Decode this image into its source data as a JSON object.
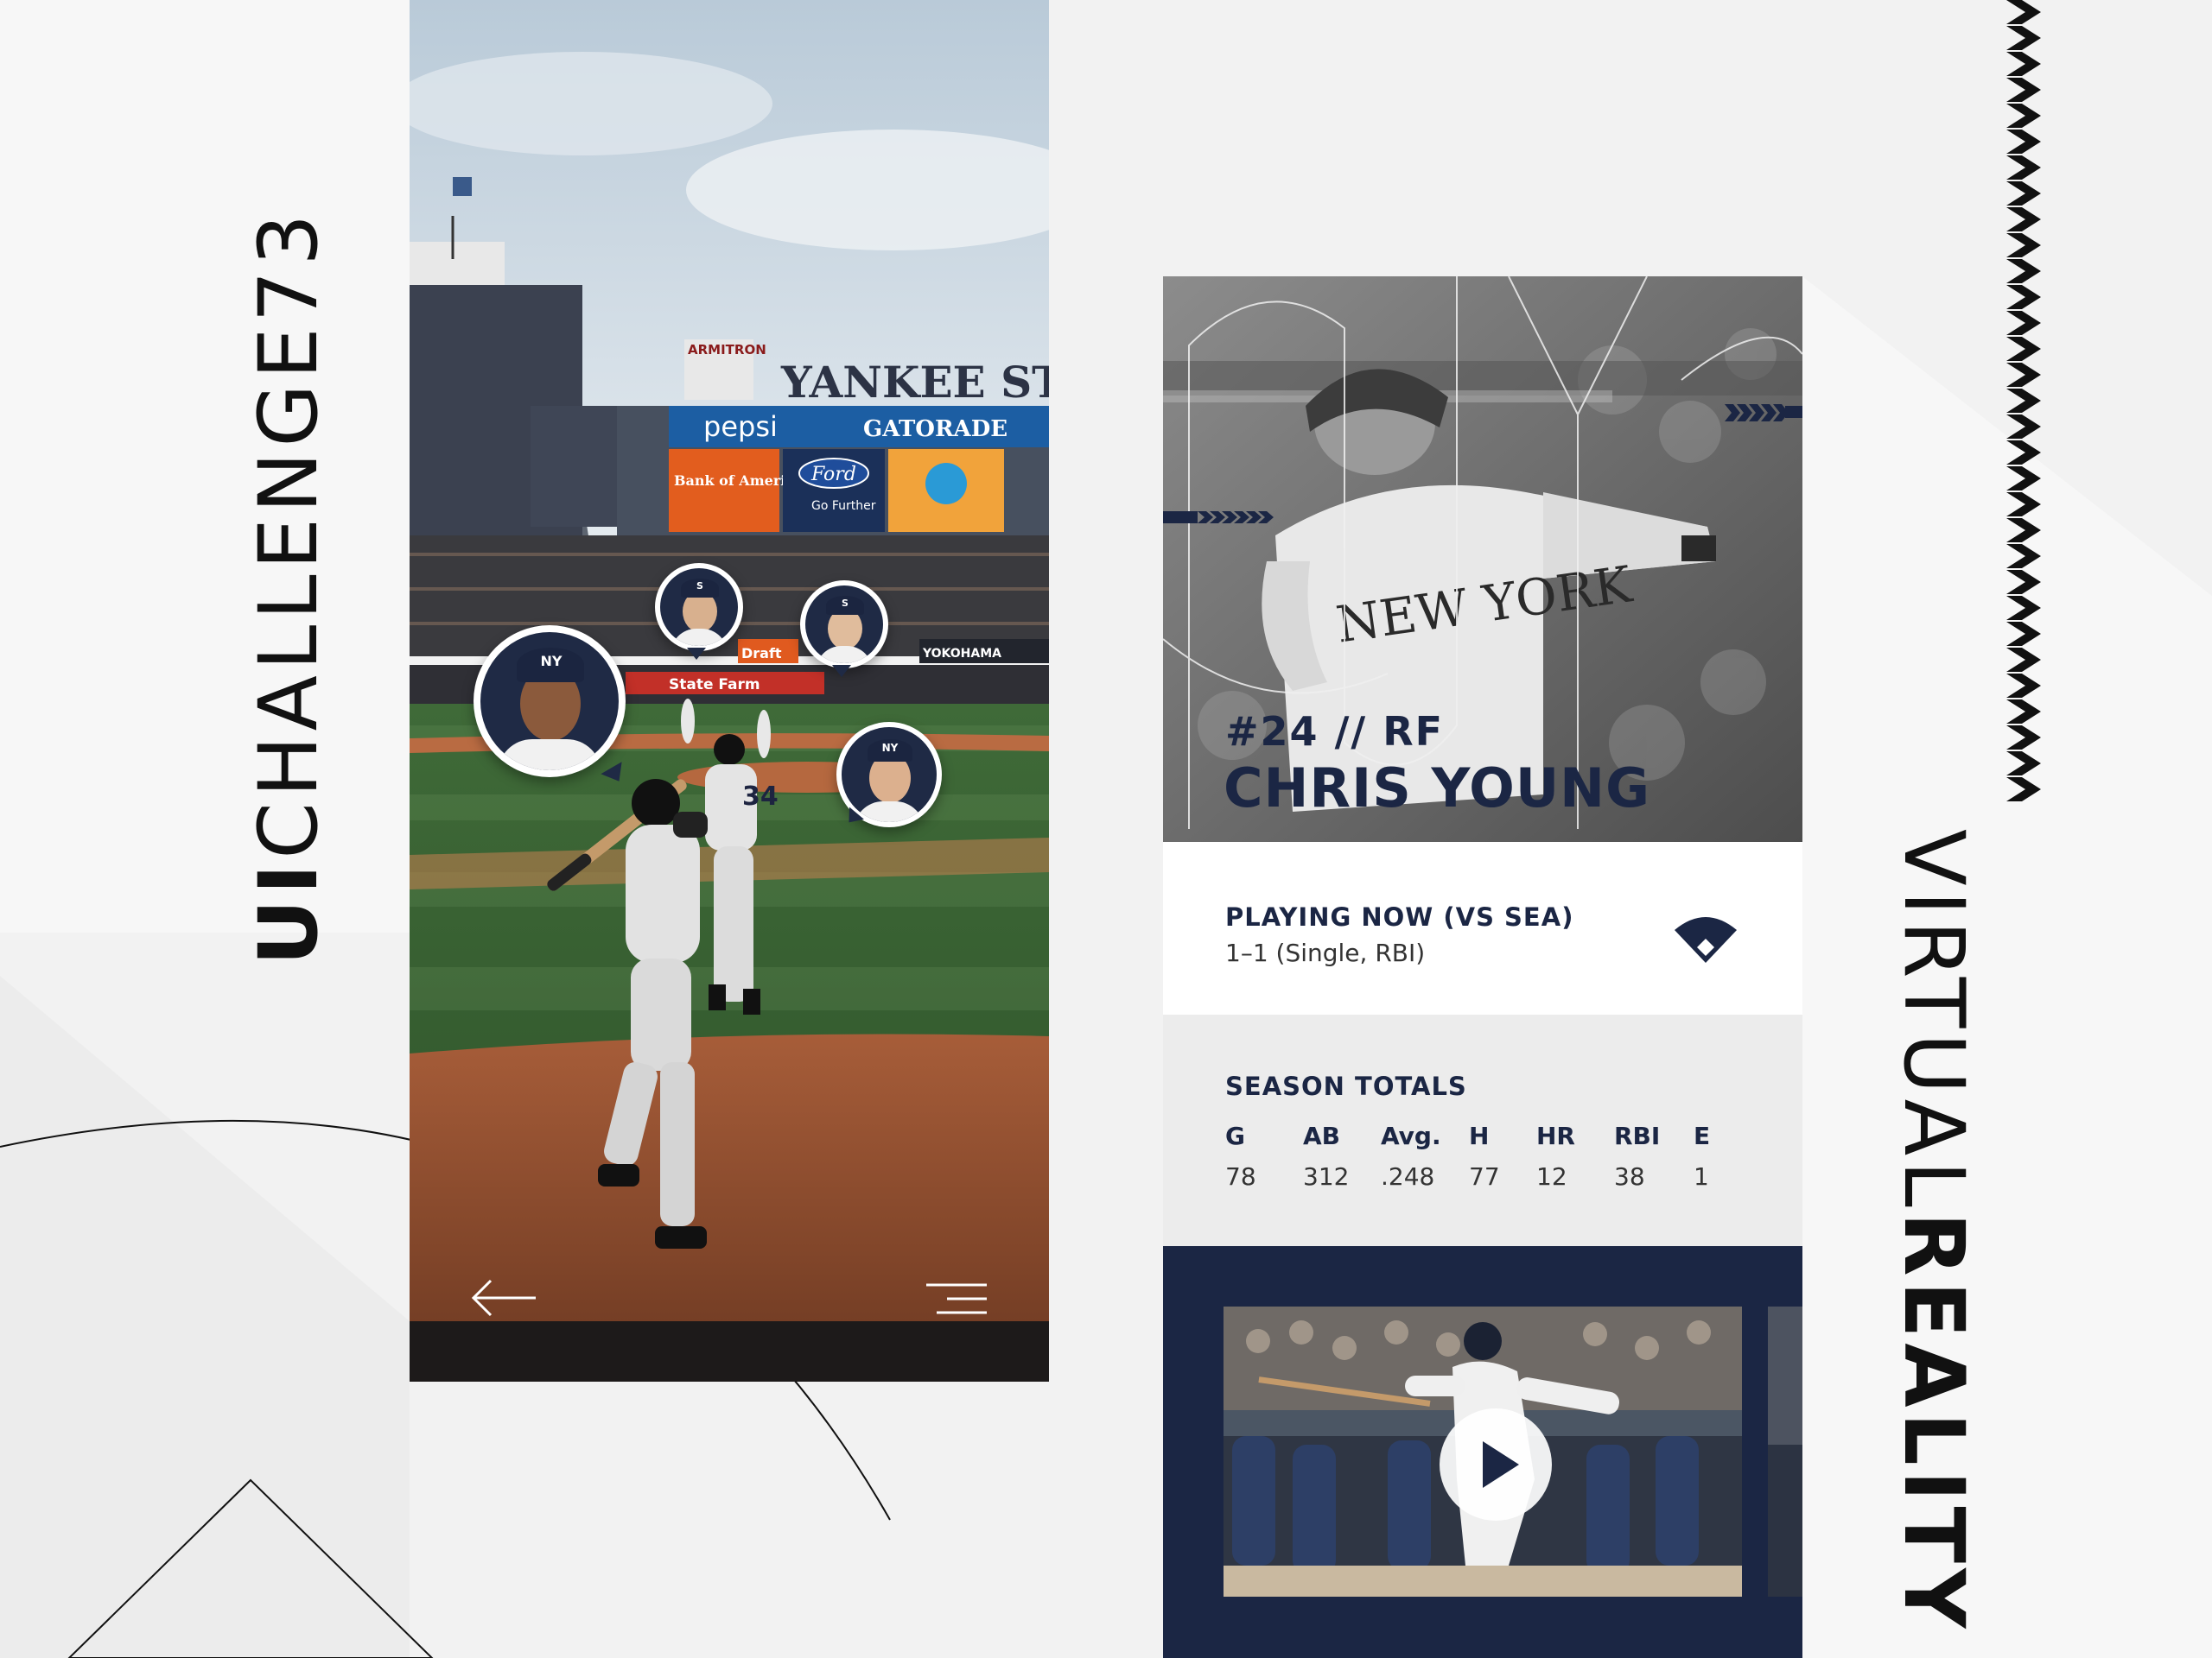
{
  "branding": {
    "left_title_prefix": "UI",
    "left_title_rest": "CHALLENGE73",
    "right_title_light": "VIRTUAL",
    "right_title_bold": "REALITY"
  },
  "stadium": {
    "sign_top": "YANKEE STA",
    "ad_pepsi": "pepsi",
    "ad_gatorade": "GATORADE",
    "ad_armitron": "ARMITRON",
    "ad_bofa": "Bank of America",
    "ad_ford": "Ford",
    "ad_ford_sub": "Go Further",
    "ad_statefarm": "State Farm",
    "ad_yokohama": "YOKOHAMA",
    "ad_draft": "Draft",
    "jersey_number": "34"
  },
  "player_bubbles": [
    {
      "cap_mark": "NY"
    },
    {
      "cap_mark": "S"
    },
    {
      "cap_mark": "S"
    },
    {
      "cap_mark": "NY"
    }
  ],
  "card": {
    "hero_jersey_text": "NEW YORK",
    "number_position": "#24 // RF",
    "name": "CHRIS YOUNG",
    "playing_now_label": "PLAYING NOW (VS SEA)",
    "playing_now_value": "1–1 (Single, RBI)",
    "season_totals_label": "SEASON TOTALS",
    "stats": [
      {
        "head": "G",
        "value": "78"
      },
      {
        "head": "AB",
        "value": "312"
      },
      {
        "head": "Avg.",
        "value": ".248"
      },
      {
        "head": "H",
        "value": "77"
      },
      {
        "head": "HR",
        "value": "12"
      },
      {
        "head": "RBI",
        "value": "38"
      },
      {
        "head": "E",
        "value": "1"
      }
    ]
  },
  "colors": {
    "navy": "#1b2644",
    "background": "#f2f2f2"
  },
  "icons": [
    "back-arrow-icon",
    "menu-icon",
    "baseball-field-icon",
    "play-icon",
    "chevron-icon"
  ]
}
